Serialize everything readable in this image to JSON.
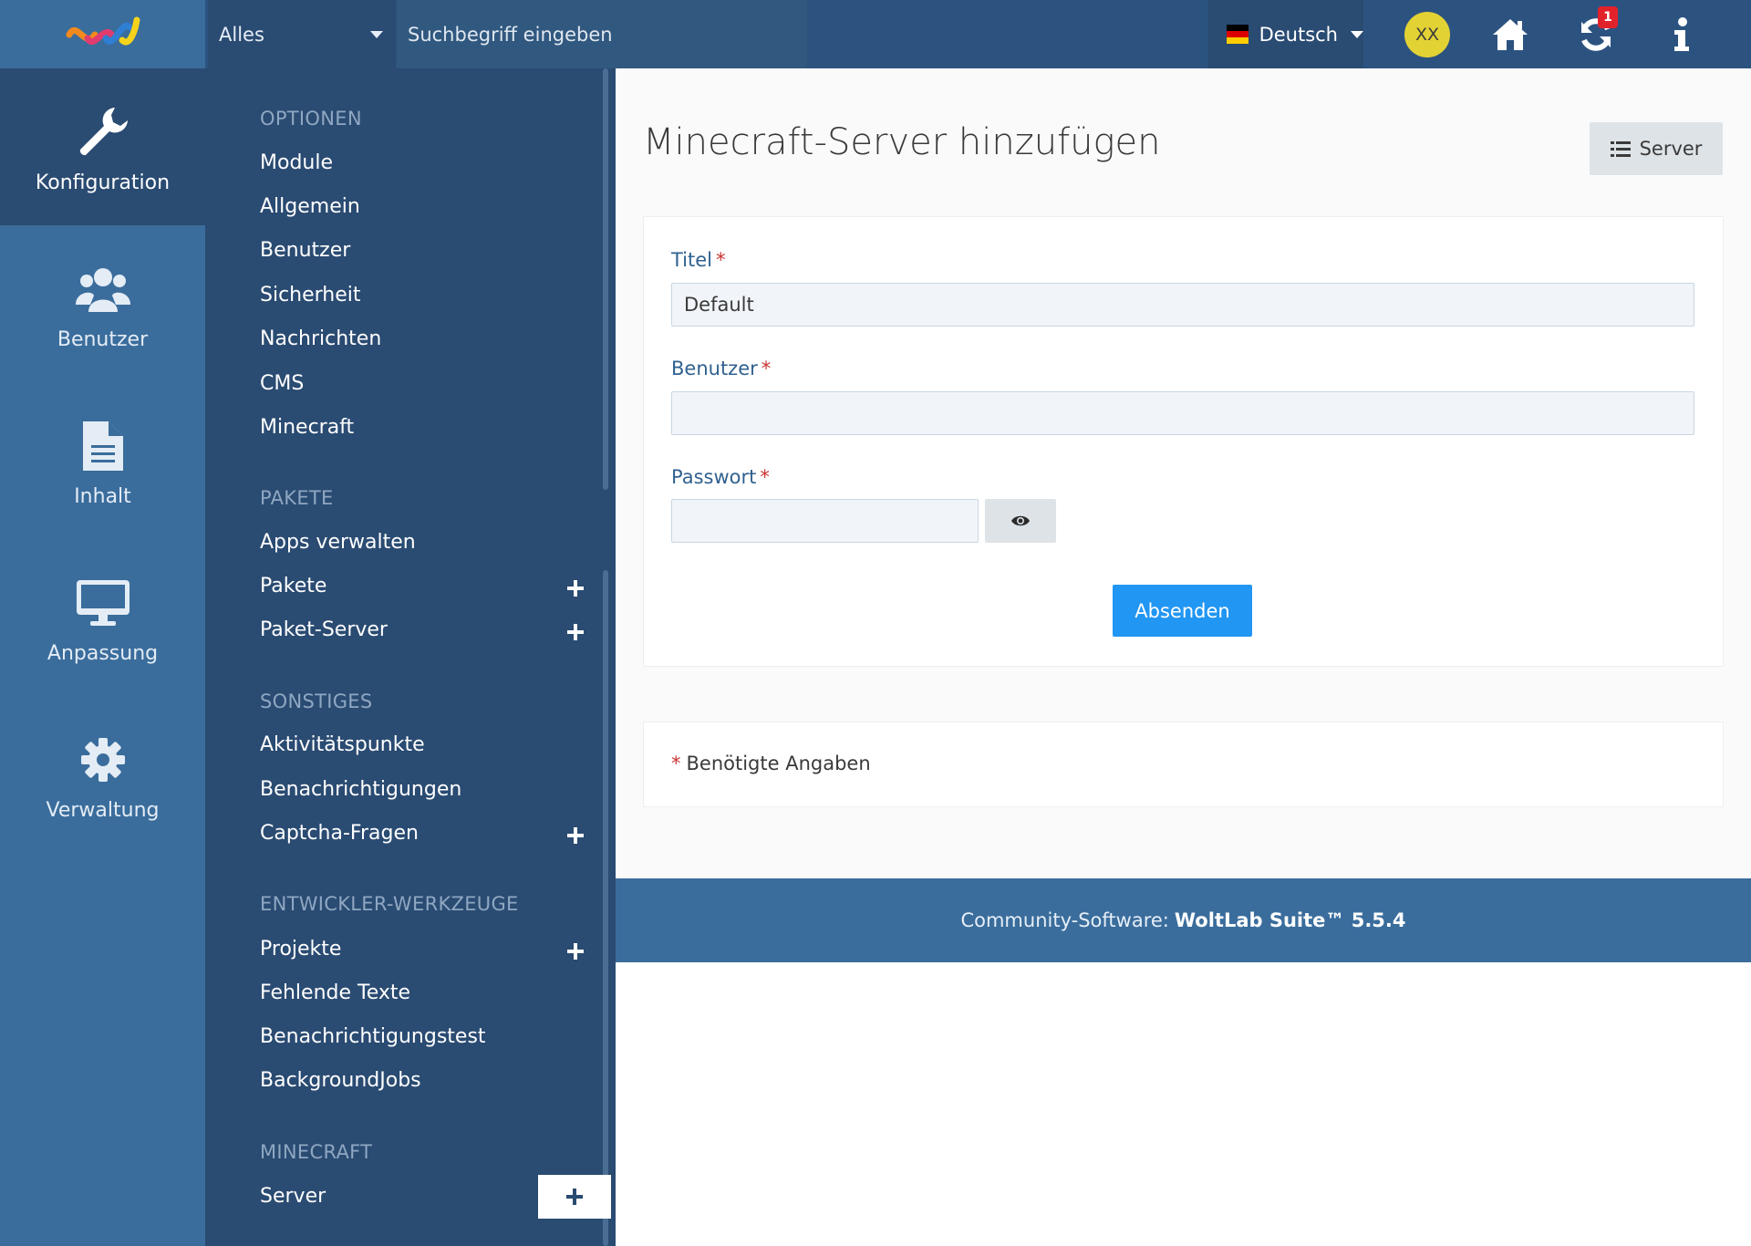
{
  "header": {
    "search_scope": "Alles",
    "search_placeholder": "Suchbegriff eingeben",
    "language": "Deutsch",
    "avatar_initials": "XX",
    "updates_badge": "1"
  },
  "mainnav": {
    "items": [
      {
        "label": "Konfiguration",
        "icon": "wrench-icon",
        "active": true
      },
      {
        "label": "Benutzer",
        "icon": "users-icon",
        "active": false
      },
      {
        "label": "Inhalt",
        "icon": "document-icon",
        "active": false
      },
      {
        "label": "Anpassung",
        "icon": "monitor-icon",
        "active": false
      },
      {
        "label": "Verwaltung",
        "icon": "gear-icon",
        "active": false
      }
    ]
  },
  "subnav": {
    "sections": [
      {
        "title": "OPTIONEN",
        "items": [
          "Module",
          "Allgemein",
          "Benutzer",
          "Sicherheit",
          "Nachrichten",
          "CMS",
          "Minecraft"
        ]
      },
      {
        "title": "PAKETE",
        "items": [
          "Apps verwalten",
          "Pakete",
          "Paket-Server"
        ]
      },
      {
        "title": "SONSTIGES",
        "items": [
          "Aktivitätspunkte",
          "Benachrichtigungen",
          "Captcha-Fragen"
        ]
      },
      {
        "title": "ENTWICKLER-WERKZEUGE",
        "items": [
          "Projekte",
          "Fehlende Texte",
          "Benachrichtigungstest",
          "BackgroundJobs"
        ]
      },
      {
        "title": "MINECRAFT",
        "items": [
          "Server"
        ]
      }
    ]
  },
  "content": {
    "title": "Minecraft-Server hinzufügen",
    "list_button": "Server",
    "fields": {
      "title_label": "Titel",
      "title_value": "Default",
      "user_label": "Benutzer",
      "user_value": "",
      "password_label": "Passwort",
      "password_value": ""
    },
    "required_mark": "*",
    "submit": "Absenden",
    "required_note": "Benötigte Angaben"
  },
  "footer": {
    "prefix": "Community-Software:",
    "product": "WoltLab Suite™ 5.5.4"
  },
  "colors": {
    "header_bg": "#2c5380",
    "mainnav_bg": "#3a6d9c",
    "subnav_bg": "#2a4b72",
    "accent": "#2196f3",
    "badge": "#e2222b",
    "avatar": "#e3d234"
  }
}
